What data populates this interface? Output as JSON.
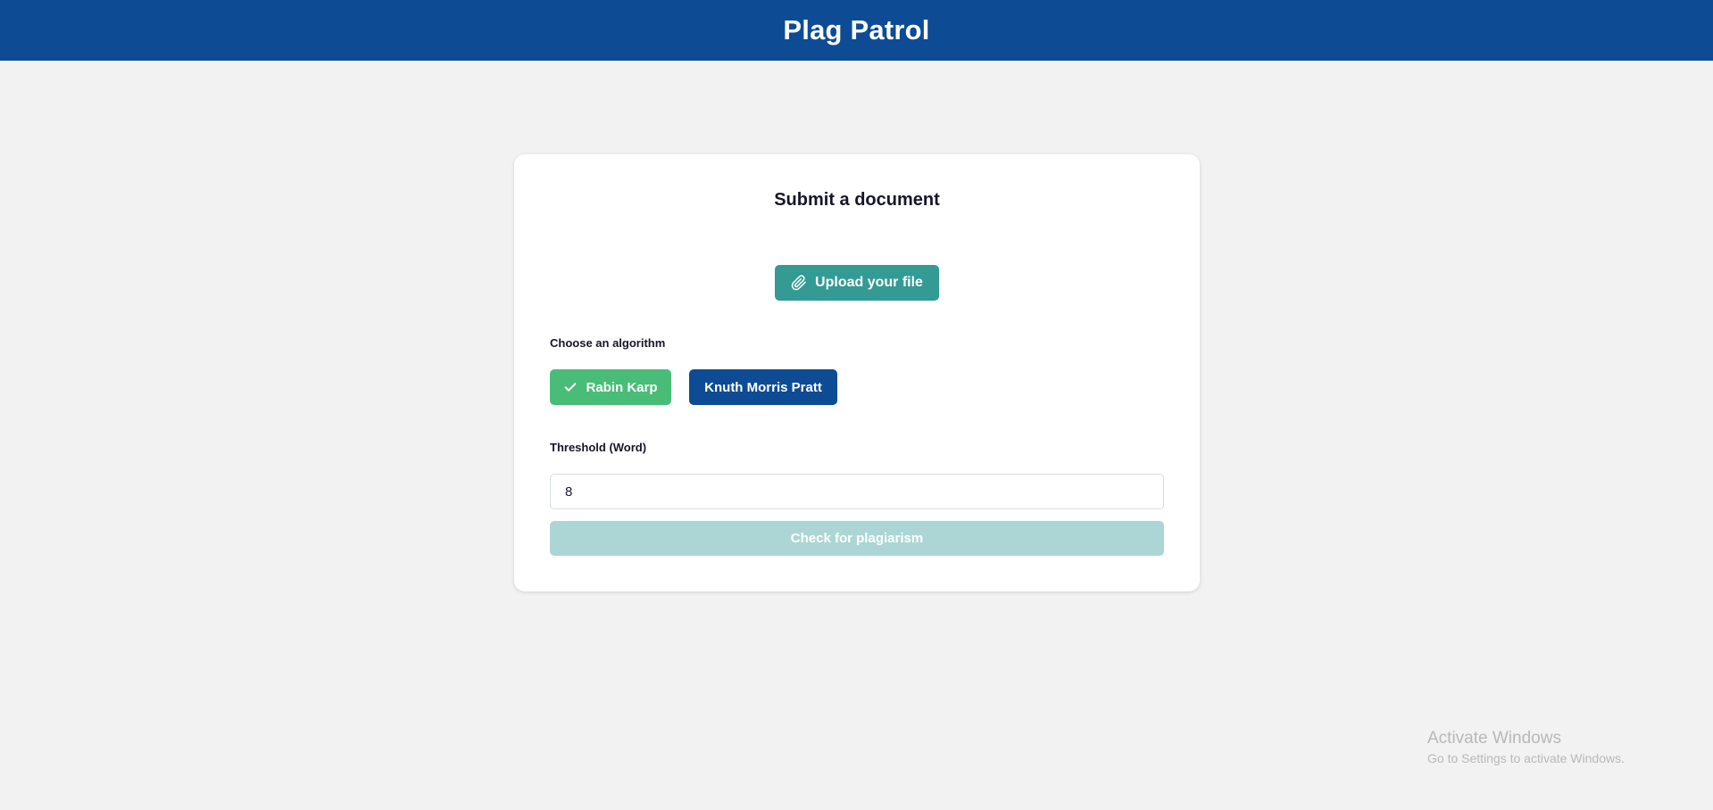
{
  "header": {
    "title": "Plag Patrol"
  },
  "card": {
    "title": "Submit a document",
    "upload_label": "Upload your file",
    "upload_icon": "paperclip-icon",
    "algorithm_label": "Choose an algorithm",
    "algorithms": [
      {
        "label": "Rabin Karp",
        "selected": true,
        "icon": "check-icon"
      },
      {
        "label": "Knuth Morris Pratt",
        "selected": false
      }
    ],
    "threshold_label": "Threshold (Word)",
    "threshold_value": "8",
    "submit_label": "Check for plagiarism"
  },
  "watermark": {
    "title": "Activate Windows",
    "subtitle": "Go to Settings to activate Windows."
  },
  "colors": {
    "header_bg": "#0d4c94",
    "upload_bg": "#339a94",
    "selected_algo_bg": "#49bd77",
    "algo_bg": "#0d4c94",
    "submit_disabled_bg": "#acd6d5",
    "page_bg": "#f2f2f2"
  }
}
